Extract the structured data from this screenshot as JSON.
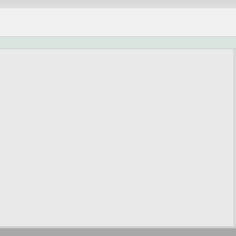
{
  "list": {
    "items": [
      {
        "label": ""
      },
      {
        "label": ""
      },
      {
        "label": ""
      },
      {
        "label": ""
      },
      {
        "label": ""
      },
      {
        "label": ""
      }
    ]
  }
}
